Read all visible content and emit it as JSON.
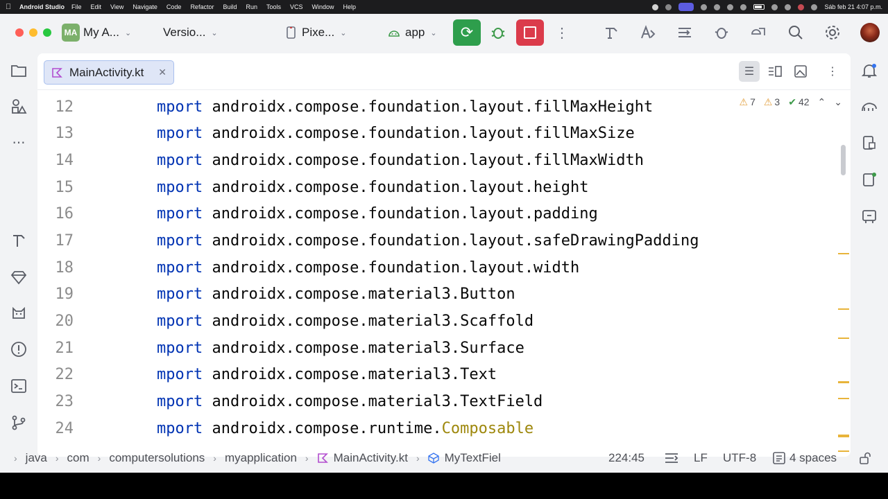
{
  "menubar": {
    "app_name": "Android Studio",
    "menus": [
      "File",
      "Edit",
      "View",
      "Navigate",
      "Code",
      "Refactor",
      "Build",
      "Run",
      "Tools",
      "VCS",
      "Window",
      "Help"
    ],
    "clock": "Sáb feb 21  4:07 p.m."
  },
  "toolbar": {
    "project_badge": "MA",
    "project_name": "My A...",
    "vcs_label": "Versio...",
    "device_label": "Pixe...",
    "run_config": "app",
    "accent_run": "#2e9e4c",
    "accent_stop": "#db3b4b"
  },
  "editor": {
    "tab_label": "MainActivity.kt",
    "inspections": {
      "warnings_a": "7",
      "warnings_b": "3",
      "ok": "42"
    },
    "lines": [
      {
        "num": "12",
        "kw": "mport",
        "code": " androidx.compose.foundation.layout.fillMaxHeight",
        "ann": ""
      },
      {
        "num": "13",
        "kw": "mport",
        "code": " androidx.compose.foundation.layout.fillMaxSize",
        "ann": ""
      },
      {
        "num": "14",
        "kw": "mport",
        "code": " androidx.compose.foundation.layout.fillMaxWidth",
        "ann": ""
      },
      {
        "num": "15",
        "kw": "mport",
        "code": " androidx.compose.foundation.layout.height",
        "ann": ""
      },
      {
        "num": "16",
        "kw": "mport",
        "code": " androidx.compose.foundation.layout.padding",
        "ann": ""
      },
      {
        "num": "17",
        "kw": "mport",
        "code": " androidx.compose.foundation.layout.safeDrawingPadding",
        "ann": ""
      },
      {
        "num": "18",
        "kw": "mport",
        "code": " androidx.compose.foundation.layout.width",
        "ann": ""
      },
      {
        "num": "19",
        "kw": "mport",
        "code": " androidx.compose.material3.Button",
        "ann": ""
      },
      {
        "num": "20",
        "kw": "mport",
        "code": " androidx.compose.material3.Scaffold",
        "ann": ""
      },
      {
        "num": "21",
        "kw": "mport",
        "code": " androidx.compose.material3.Surface",
        "ann": ""
      },
      {
        "num": "22",
        "kw": "mport",
        "code": " androidx.compose.material3.Text",
        "ann": ""
      },
      {
        "num": "23",
        "kw": "mport",
        "code": " androidx.compose.material3.TextField",
        "ann": ""
      },
      {
        "num": "24",
        "kw": "mport",
        "code": " androidx.compose.runtime.",
        "ann": "Composable"
      }
    ]
  },
  "statusbar": {
    "breadcrumbs": [
      "java",
      "com",
      "computersolutions",
      "myapplication",
      "MainActivity.kt",
      "MyTextFiel"
    ],
    "position": "224:45",
    "line_separator": "LF",
    "encoding": "UTF-8",
    "indent": "4 spaces"
  }
}
